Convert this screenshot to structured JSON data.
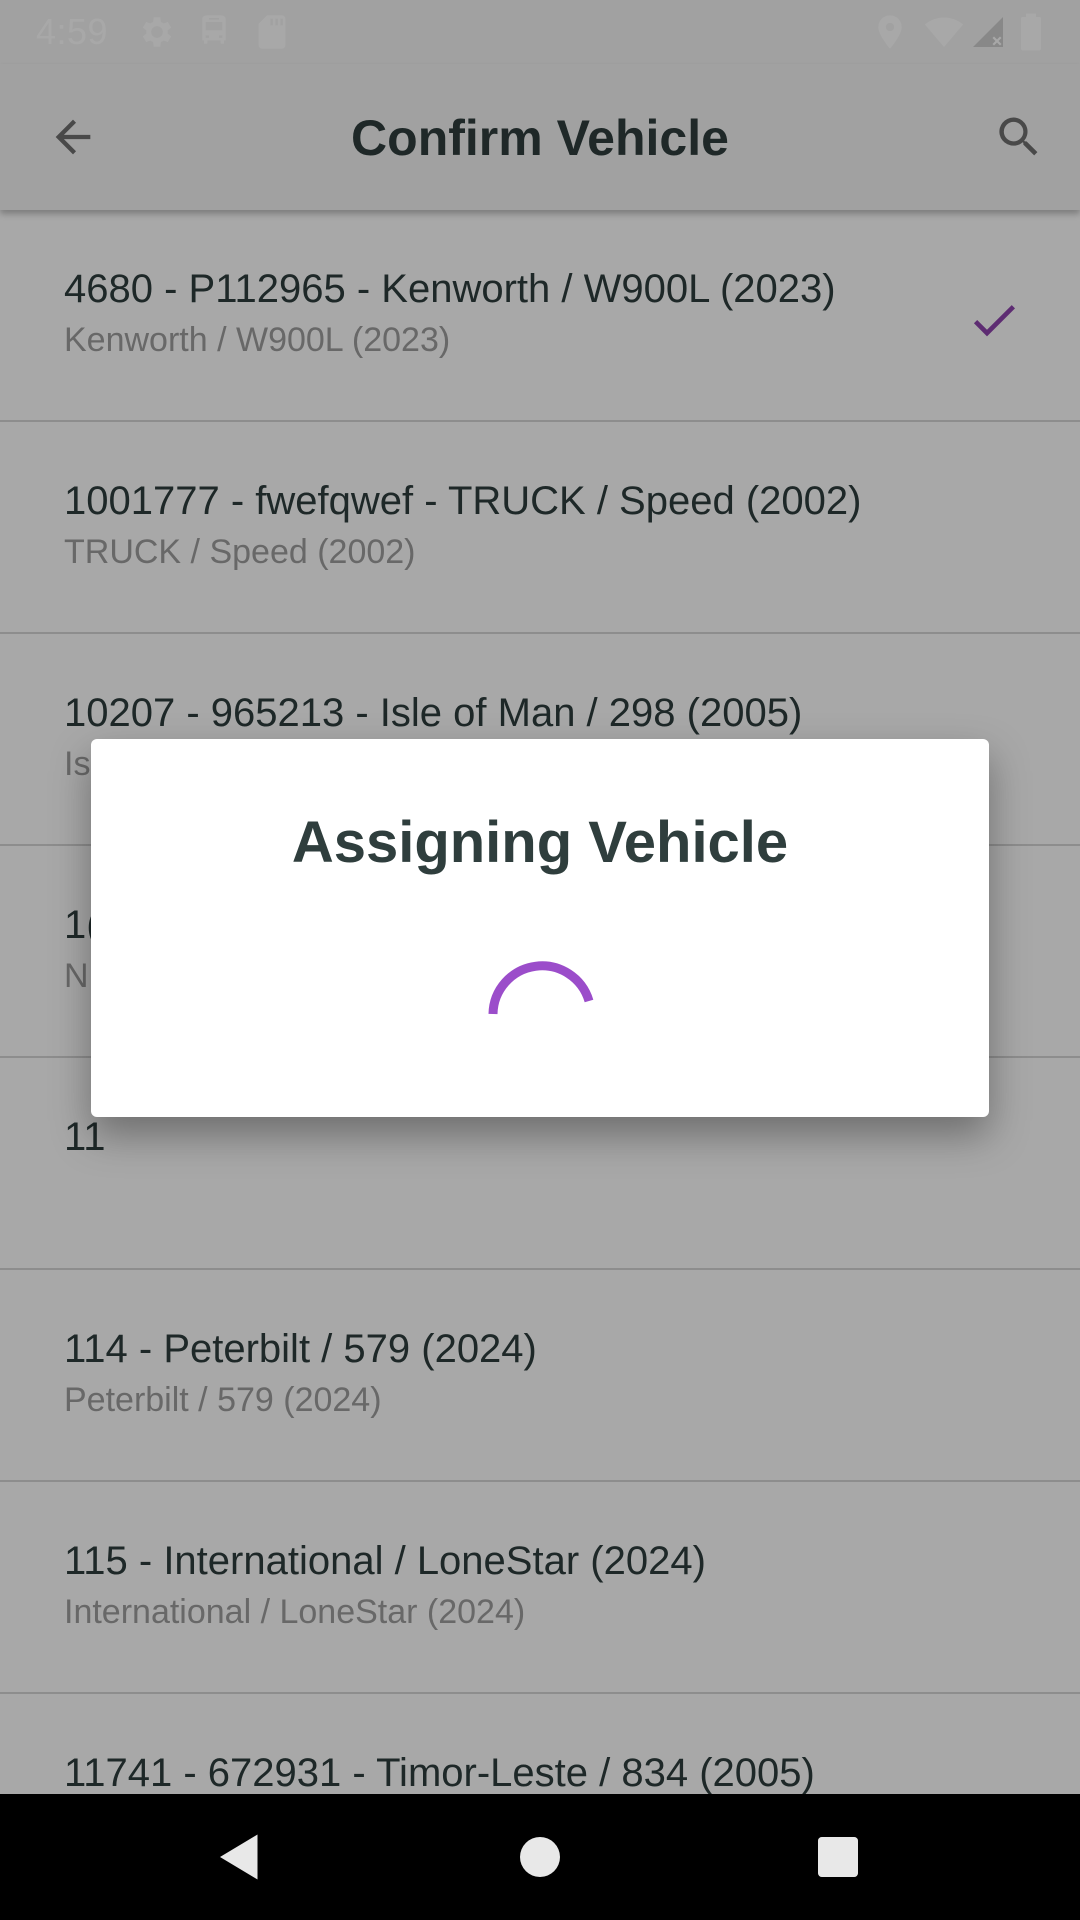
{
  "status_bar": {
    "time": "4:59",
    "left_icons": [
      "gear-icon",
      "bus-icon",
      "sd-card-icon"
    ],
    "right_icons": [
      "location-icon",
      "wifi-icon",
      "signal-icon",
      "battery-icon"
    ]
  },
  "app_bar": {
    "title": "Confirm Vehicle",
    "back_icon": "arrow-back-icon",
    "search_icon": "search-icon"
  },
  "vehicles": [
    {
      "title": "4680 - P112965 - Kenworth / W900L (2023)",
      "subtitle": "Kenworth / W900L (2023)",
      "selected": true
    },
    {
      "title": "1001777 - fwefqwef - TRUCK / Speed (2002)",
      "subtitle": "TRUCK / Speed (2002)",
      "selected": false
    },
    {
      "title": "10207 - 965213 - Isle of Man / 298 (2005)",
      "subtitle": "Is",
      "selected": false
    },
    {
      "title": "1(",
      "subtitle": "N",
      "selected": false
    },
    {
      "title": "11",
      "subtitle": "",
      "selected": false
    },
    {
      "title": "114 - Peterbilt / 579 (2024)",
      "subtitle": "Peterbilt / 579 (2024)",
      "selected": false
    },
    {
      "title": "115 - International / LoneStar (2024)",
      "subtitle": "International / LoneStar (2024)",
      "selected": false
    },
    {
      "title": "11741 - 672931 - Timor-Leste / 834 (2005)",
      "subtitle": "",
      "selected": false
    }
  ],
  "dialog": {
    "title": "Assigning Vehicle",
    "spinner_icon": "loading-spinner-icon"
  },
  "nav_bar": {
    "icons": [
      "nav-back-icon",
      "nav-home-icon",
      "nav-recents-icon"
    ]
  },
  "colors": {
    "accent": "#8e44ad",
    "title_text": "#2f3e3d",
    "subtitle_text": "#9e9e9e"
  }
}
